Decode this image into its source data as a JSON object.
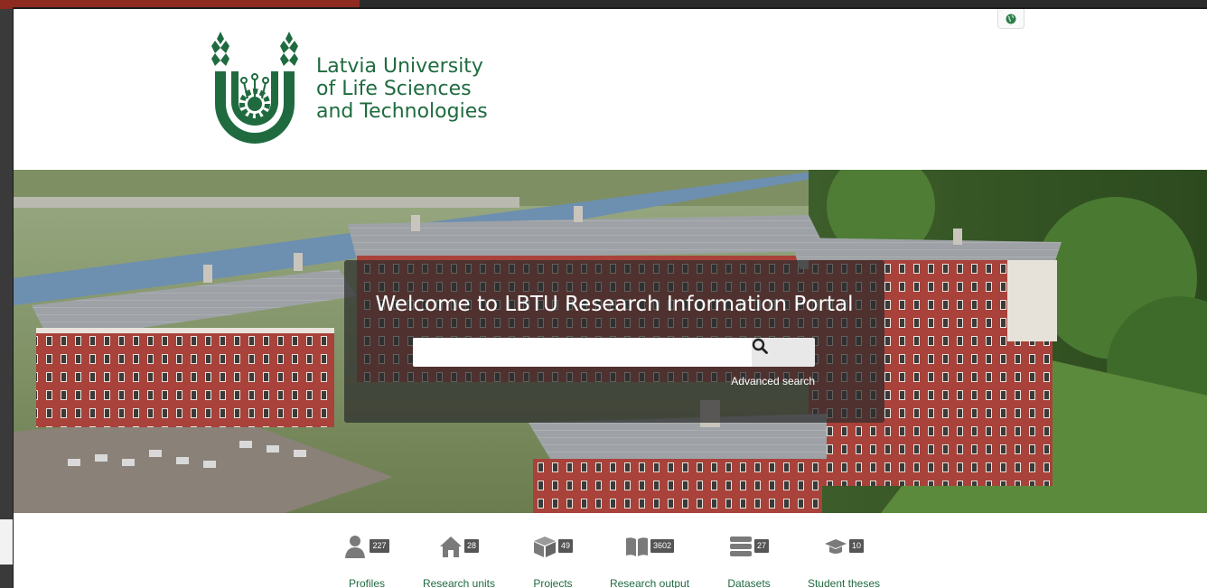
{
  "header": {
    "logo_lines": [
      "Latvia University",
      "of Life Sciences",
      "and Technologies"
    ],
    "language_icon": "globe-icon"
  },
  "hero": {
    "welcome": "Welcome to LBTU Research Information Portal",
    "search": {
      "value": "",
      "placeholder": ""
    },
    "search_icon": "search-icon",
    "advanced_search": "Advanced search"
  },
  "categories": [
    {
      "label": "Profiles",
      "count": "227",
      "icon": "person-icon"
    },
    {
      "label": "Research units",
      "count": "28",
      "icon": "house-icon"
    },
    {
      "label": "Projects",
      "count": "49",
      "icon": "cube-icon"
    },
    {
      "label": "Research output",
      "count": "3602",
      "icon": "book-icon"
    },
    {
      "label": "Datasets",
      "count": "27",
      "icon": "database-icon"
    },
    {
      "label": "Student theses",
      "count": "10",
      "icon": "graduation-cap-icon"
    }
  ],
  "colors": {
    "brand_green": "#1f6b3f",
    "overlay": "#2d2d2d",
    "badge": "#555555"
  }
}
